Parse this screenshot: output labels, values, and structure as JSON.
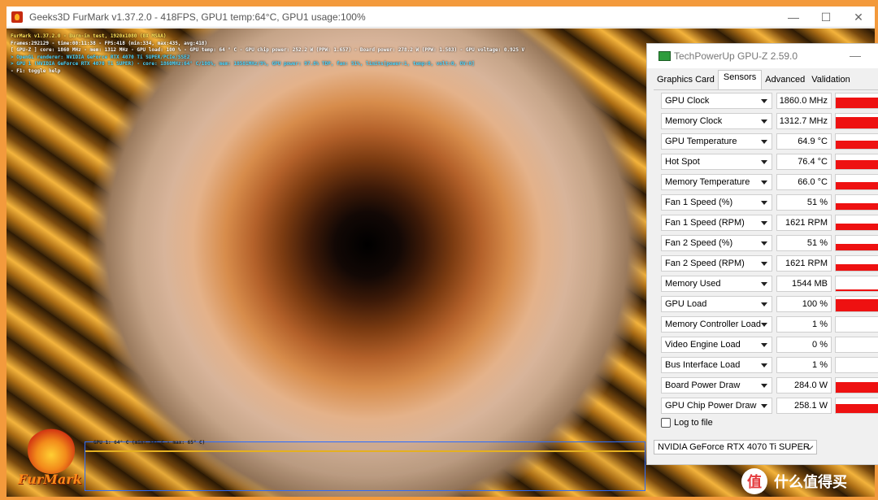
{
  "furmark": {
    "title": "Geeks3D FurMark v1.37.2.0 - 418FPS, GPU1 temp:64°C, GPU1 usage:100%",
    "hud": [
      {
        "text": "FurMark v1.37.2.0 - Burn-in test, 1920x1080 (0X MSAA)",
        "color": "y"
      },
      {
        "text": "Frames:292129 - time:00:11:38 - FPS:418 (min:334, max:435, avg:418)",
        "color": "w"
      },
      {
        "text": "[ GPU-Z ] core: 1860 MHz - mem: 1312 MHz - GPU load: 100 % - GPU temp: 64 ° C - GPU chip power: 252.2 W (PPW: 1.657) - Board power: 278.2 W (PPW: 1.503) - GPU voltage: 0.925 V",
        "color": "w"
      },
      {
        "text": "> OpenGL renderer: NVIDIA GeForce RTX 4070 Ti SUPER/PCIe/SSE2",
        "color": "c"
      },
      {
        "text": "> GPU 1 (NVIDIA GeForce RTX 4070 Ti SUPER) - core: 1860MHz:64° C/100%, mem: 10501MHz/9%, GPU power: 97.8% TDP, fan: 51%, limits[power:1, temp:0, volt:0, OV:0]",
        "color": "c"
      },
      {
        "text": "- F1: toggle help",
        "color": "w"
      }
    ],
    "graph_label": "GPU 1: 64° C (min: 34° C - max: 65° C)",
    "logo_text": "FurMark"
  },
  "gpuz": {
    "title": "TechPowerUp GPU-Z 2.59.0",
    "tabs": [
      "Graphics Card",
      "Sensors",
      "Advanced",
      "Validation"
    ],
    "active_tab": "Sensors",
    "sensors": [
      {
        "name": "GPU Clock",
        "value": "1860.0 MHz",
        "level": 0.75
      },
      {
        "name": "Memory Clock",
        "value": "1312.7 MHz",
        "level": 0.8
      },
      {
        "name": "GPU Temperature",
        "value": "64.9 °C",
        "level": 0.55
      },
      {
        "name": "Hot Spot",
        "value": "76.4 °C",
        "level": 0.6
      },
      {
        "name": "Memory Temperature",
        "value": "66.0 °C",
        "level": 0.5
      },
      {
        "name": "Fan 1 Speed (%)",
        "value": "51 %",
        "level": 0.45
      },
      {
        "name": "Fan 1 Speed (RPM)",
        "value": "1621 RPM",
        "level": 0.45
      },
      {
        "name": "Fan 2 Speed (%)",
        "value": "51 %",
        "level": 0.45
      },
      {
        "name": "Fan 2 Speed (RPM)",
        "value": "1621 RPM",
        "level": 0.45
      },
      {
        "name": "Memory Used",
        "value": "1544 MB",
        "level": 0.12
      },
      {
        "name": "GPU Load",
        "value": "100 %",
        "level": 0.85
      },
      {
        "name": "Memory Controller Load",
        "value": "1 %",
        "level": 0.01
      },
      {
        "name": "Video Engine Load",
        "value": "0 %",
        "level": 0.0
      },
      {
        "name": "Bus Interface Load",
        "value": "1 %",
        "level": 0.01
      },
      {
        "name": "Board Power Draw",
        "value": "284.0 W",
        "level": 0.7
      },
      {
        "name": "GPU Chip Power Draw",
        "value": "258.1 W",
        "level": 0.6
      }
    ],
    "log_label": "Log to file",
    "gpu_select": "NVIDIA GeForce RTX 4070 Ti SUPER"
  },
  "watermark": {
    "badge": "值",
    "text": "什么值得买"
  }
}
